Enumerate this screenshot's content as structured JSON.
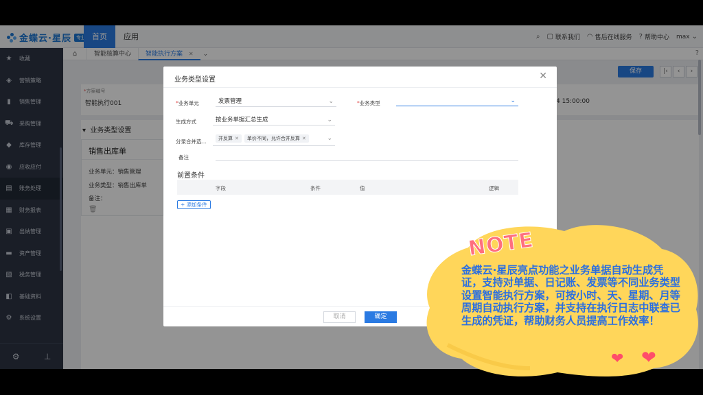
{
  "topbar": {
    "logo_text": "金蝶云·星辰",
    "logo_badge": "专业版",
    "nav_home": "首页",
    "nav_app": "应用",
    "contact": "联系我们",
    "support": "售后在线服务",
    "help": "帮助中心",
    "user": "max"
  },
  "sidebar": {
    "items": [
      {
        "label": "收藏",
        "icon": "★"
      },
      {
        "label": "营销策略",
        "icon": "◈"
      },
      {
        "label": "销售管理",
        "icon": "▮"
      },
      {
        "label": "采购管理",
        "icon": "⛟"
      },
      {
        "label": "库存管理",
        "icon": "◆"
      },
      {
        "label": "应收应付",
        "icon": "◉"
      },
      {
        "label": "账务处理",
        "icon": "▤"
      },
      {
        "label": "财务报表",
        "icon": "▦"
      },
      {
        "label": "出纳管理",
        "icon": "▣"
      },
      {
        "label": "资产管理",
        "icon": "▬"
      },
      {
        "label": "税务管理",
        "icon": "▧"
      },
      {
        "label": "基础资料",
        "icon": "◧"
      },
      {
        "label": "系统设置",
        "icon": "⚙"
      }
    ],
    "active_index": 6
  },
  "tabs": {
    "tab1": "智能核算中心",
    "tab2": "智能执行方案"
  },
  "page": {
    "save_label": "保存",
    "plan_code_label": "方案编号",
    "plan_code_value": "智能执行001",
    "time_value": "4 15:00:00",
    "section_title": "业务类型设置",
    "card_title": "销售出库单",
    "card_unit": "业务单元：销售管理",
    "card_type": "业务类型：销售出库单",
    "card_note": "备注："
  },
  "modal": {
    "title": "业务类型设置",
    "unit_label": "业务单元",
    "unit_value": "发票管理",
    "type_label": "业务类型",
    "type_value": "",
    "gen_label": "生成方式",
    "gen_value": "按业务单据汇总生成",
    "merge_label": "分录合并选...",
    "merge_tag1": "并反算",
    "merge_tag2": "单价不同，允许合并反算",
    "note_label": "备注",
    "pre_title": "前置条件",
    "col_field": "字段",
    "col_cond": "条件",
    "col_value": "值",
    "col_logic": "逻辑",
    "add_label": "添加条件",
    "cancel_label": "取消",
    "ok_label": "确定"
  },
  "note": {
    "title": "NOTE",
    "text": "金蝶云·星辰亮点功能之业务单据自动生成凭证，支持对单据、日记账、发票等不同业务类型设置智能执行方案，可按小时、天、星期、月等周期自动执行方案，并支持在执行日志中联查已生成的凭证，帮助财务人员提高工作效率！"
  },
  "colors": {
    "accent": "#2a7ae2",
    "sidebar_bg": "#2d3544",
    "note_yellow": "#ffd65a",
    "note_pink": "#ff6f7e",
    "note_blue": "#2b6fe0"
  }
}
